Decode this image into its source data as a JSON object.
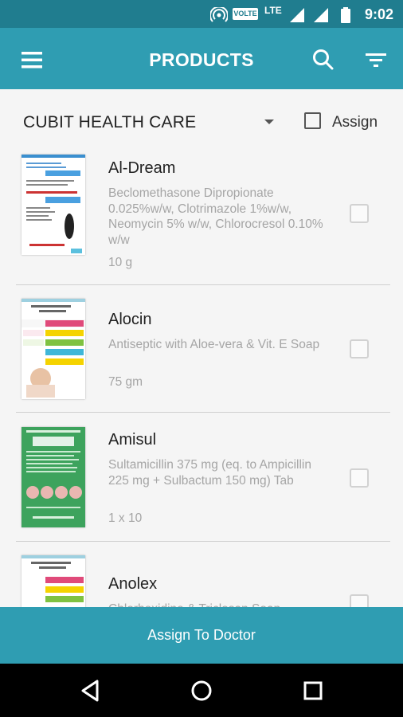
{
  "status_bar": {
    "time": "9:02",
    "network_label": "VOLTE",
    "lte_label": "LTE"
  },
  "app_bar": {
    "title": "PRODUCTS",
    "icons": [
      "menu-icon",
      "search-icon",
      "filter-icon"
    ]
  },
  "filter": {
    "company": "CUBIT HEALTH CARE",
    "assign_label": "Assign",
    "assign_checked": false
  },
  "products": [
    {
      "name": "Al-Dream",
      "description": "Beclomethasone Dipropionate 0.025%w/w, Clotrimazole 1%w/w, Neomycin 5% w/w, Chlorocresol 0.10% w/w",
      "pack": "10 g",
      "checked": false
    },
    {
      "name": "Alocin",
      "description": "Antiseptic with Aloe-vera & Vit. E Soap",
      "pack": "75 gm",
      "checked": false
    },
    {
      "name": "Amisul",
      "description": "Sultamicillin 375 mg (eq. to Ampicillin 225 mg + Sulbactum 150 mg) Tab",
      "pack": "1 x 10",
      "checked": false
    },
    {
      "name": "Anolex",
      "description": "Chlorhexidine & Triclosan Soap",
      "pack": "",
      "checked": false
    }
  ],
  "bottom_button": {
    "label": "Assign To Doctor"
  },
  "colors": {
    "status_bar": "#207d8f",
    "primary": "#2f9db2",
    "background": "#f5f5f5"
  }
}
